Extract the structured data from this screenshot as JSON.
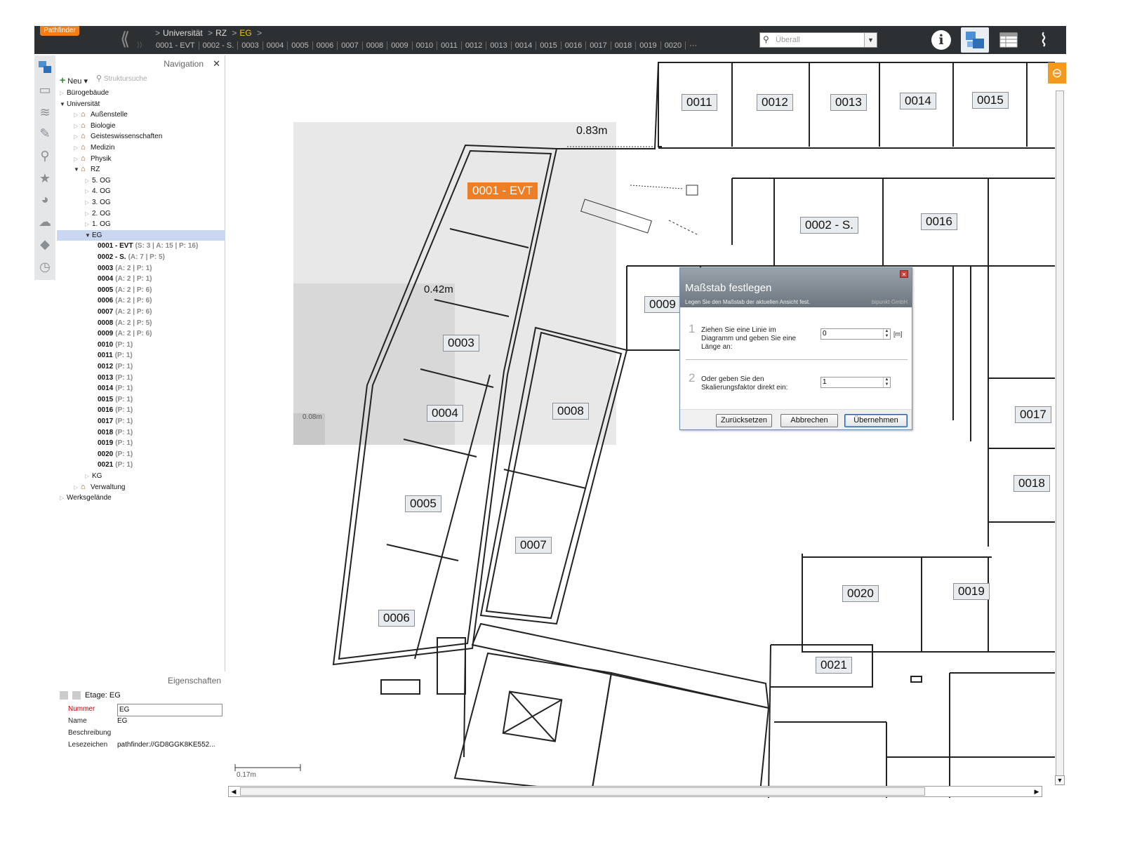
{
  "app": {
    "logo": "Pathfinder",
    "breadcrumb": [
      "Universität",
      "RZ",
      "EG"
    ],
    "room_strip": [
      "0001 - EVT",
      "0002 - S.",
      "0003",
      "0004",
      "0005",
      "0006",
      "0007",
      "0008",
      "0009",
      "0010",
      "0011",
      "0012",
      "0013",
      "0014",
      "0015",
      "0016",
      "0017",
      "0018",
      "0019",
      "0020",
      "···"
    ],
    "search_placeholder": "Überall"
  },
  "navigation": {
    "title": "Navigation",
    "new_label": "Neu",
    "search_placeholder": "Struktursuche",
    "tree": [
      {
        "label": "Bürogebäude",
        "level": 0,
        "open": false,
        "house": false
      },
      {
        "label": "Universität",
        "level": 0,
        "open": true,
        "house": false
      },
      {
        "label": "Außenstelle",
        "level": 1,
        "open": false,
        "house": true
      },
      {
        "label": "Biologie",
        "level": 1,
        "open": false,
        "house": true
      },
      {
        "label": "Geisteswissenschaften",
        "level": 1,
        "open": false,
        "house": true
      },
      {
        "label": "Medizin",
        "level": 1,
        "open": false,
        "house": true
      },
      {
        "label": "Physik",
        "level": 1,
        "open": false,
        "house": true
      },
      {
        "label": "RZ",
        "level": 1,
        "open": true,
        "house": true
      },
      {
        "label": "5. OG",
        "level": 2,
        "open": false,
        "house": false
      },
      {
        "label": "4. OG",
        "level": 2,
        "open": false,
        "house": false
      },
      {
        "label": "3. OG",
        "level": 2,
        "open": false,
        "house": false
      },
      {
        "label": "2. OG",
        "level": 2,
        "open": false,
        "house": false
      },
      {
        "label": "1. OG",
        "level": 2,
        "open": false,
        "house": false
      },
      {
        "label": "EG",
        "level": 2,
        "open": true,
        "house": false,
        "selected": true
      },
      {
        "label": "0001 - EVT",
        "meta": "(S: 3 | A: 15 | P: 16)",
        "level": 3,
        "leaf": true
      },
      {
        "label": "0002 - S.",
        "meta": "(A: 7 | P: 5)",
        "level": 3,
        "leaf": true
      },
      {
        "label": "0003",
        "meta": "(A: 2 | P: 1)",
        "level": 3,
        "leaf": true
      },
      {
        "label": "0004",
        "meta": "(A: 2 | P: 1)",
        "level": 3,
        "leaf": true
      },
      {
        "label": "0005",
        "meta": "(A: 2 | P: 6)",
        "level": 3,
        "leaf": true
      },
      {
        "label": "0006",
        "meta": "(A: 2 | P: 6)",
        "level": 3,
        "leaf": true
      },
      {
        "label": "0007",
        "meta": "(A: 2 | P: 6)",
        "level": 3,
        "leaf": true
      },
      {
        "label": "0008",
        "meta": "(A: 2 | P: 5)",
        "level": 3,
        "leaf": true
      },
      {
        "label": "0009",
        "meta": "(A: 2 | P: 6)",
        "level": 3,
        "leaf": true
      },
      {
        "label": "0010",
        "meta": "(P: 1)",
        "level": 3,
        "leaf": true
      },
      {
        "label": "0011",
        "meta": "(P: 1)",
        "level": 3,
        "leaf": true
      },
      {
        "label": "0012",
        "meta": "(P: 1)",
        "level": 3,
        "leaf": true
      },
      {
        "label": "0013",
        "meta": "(P: 1)",
        "level": 3,
        "leaf": true
      },
      {
        "label": "0014",
        "meta": "(P: 1)",
        "level": 3,
        "leaf": true
      },
      {
        "label": "0015",
        "meta": "(P: 1)",
        "level": 3,
        "leaf": true
      },
      {
        "label": "0016",
        "meta": "(P: 1)",
        "level": 3,
        "leaf": true
      },
      {
        "label": "0017",
        "meta": "(P: 1)",
        "level": 3,
        "leaf": true
      },
      {
        "label": "0018",
        "meta": "(P: 1)",
        "level": 3,
        "leaf": true
      },
      {
        "label": "0019",
        "meta": "(P: 1)",
        "level": 3,
        "leaf": true
      },
      {
        "label": "0020",
        "meta": "(P: 1)",
        "level": 3,
        "leaf": true
      },
      {
        "label": "0021",
        "meta": "(P: 1)",
        "level": 3,
        "leaf": true
      },
      {
        "label": "KG",
        "level": 2,
        "open": false,
        "house": false
      },
      {
        "label": "Verwaltung",
        "level": 1,
        "open": false,
        "house": true
      },
      {
        "label": "Werksgelände",
        "level": 0,
        "open": false,
        "house": false
      }
    ]
  },
  "properties": {
    "title": "Eigenschaften",
    "header": "Etage: EG",
    "rows": [
      {
        "key": "Nummer",
        "value": "EG",
        "highlight": true
      },
      {
        "key": "Name",
        "value": "EG"
      },
      {
        "key": "Beschreibung",
        "value": ""
      },
      {
        "key": "Lesezeichen",
        "value": "pathfinder://GD8GGK8KE552..."
      }
    ]
  },
  "plan": {
    "rooms": [
      {
        "id": "0001",
        "label": "0001 - EVT",
        "active": true
      },
      {
        "id": "0002",
        "label": "0002 - S."
      },
      {
        "id": "0003",
        "label": "0003"
      },
      {
        "id": "0004",
        "label": "0004"
      },
      {
        "id": "0005",
        "label": "0005"
      },
      {
        "id": "0006",
        "label": "0006"
      },
      {
        "id": "0007",
        "label": "0007"
      },
      {
        "id": "0008",
        "label": "0008"
      },
      {
        "id": "0009",
        "label": "0009"
      },
      {
        "id": "0011",
        "label": "0011"
      },
      {
        "id": "0012",
        "label": "0012"
      },
      {
        "id": "0013",
        "label": "0013"
      },
      {
        "id": "0014",
        "label": "0014"
      },
      {
        "id": "0015",
        "label": "0015"
      },
      {
        "id": "0016",
        "label": "0016"
      },
      {
        "id": "0017",
        "label": "0017"
      },
      {
        "id": "0018",
        "label": "0018"
      },
      {
        "id": "0019",
        "label": "0019"
      },
      {
        "id": "0020",
        "label": "0020"
      },
      {
        "id": "0021",
        "label": "0021"
      }
    ],
    "dimensions": [
      "0.83m",
      "0.42m",
      "0.08m"
    ],
    "scale_bar": "0.17m"
  },
  "dialog": {
    "title": "Maßstab festlegen",
    "subtitle": "Legen Sie den Maßstab der aktuellen Ansicht fest.",
    "brand": "bipunkt GmbH",
    "step1_num": "1",
    "step1_text": "Ziehen Sie eine Linie im Diagramm und geben Sie eine Länge an:",
    "step1_value": "0",
    "step1_unit": "[m]",
    "step2_num": "2",
    "step2_text": "Oder geben Sie den Skalierungsfaktor direkt ein:",
    "step2_value": "1",
    "btn_reset": "Zurücksetzen",
    "btn_cancel": "Abbrechen",
    "btn_apply": "Übernehmen"
  }
}
